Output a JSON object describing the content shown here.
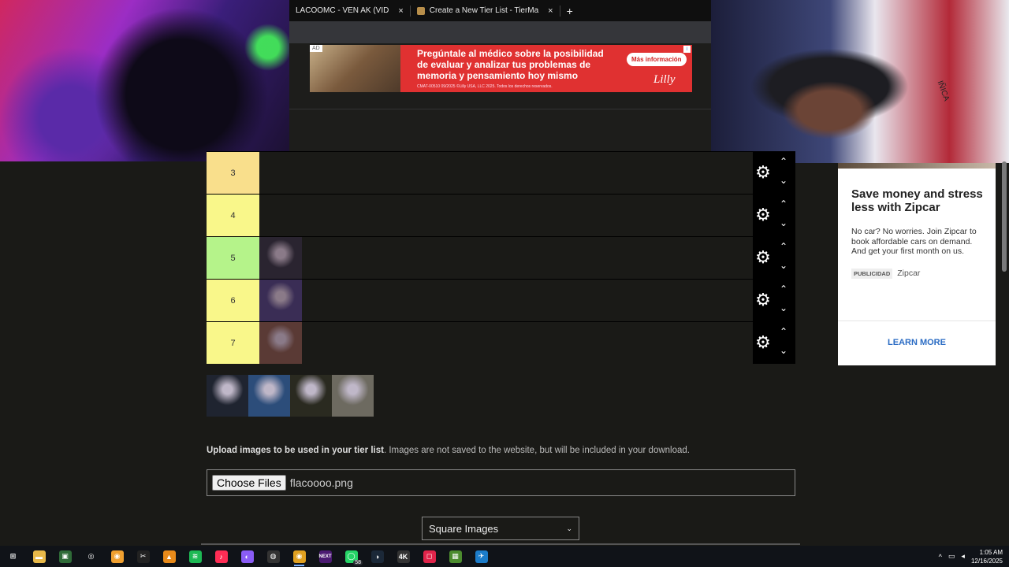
{
  "browser": {
    "tabs": [
      {
        "label": "LACOOMC - VEN AK (VID",
        "close": "×"
      },
      {
        "label": "Create a New Tier List - TierMa",
        "close": "×"
      }
    ],
    "new_tab": "+"
  },
  "top_ad": {
    "badge": "AD",
    "headline": "Pregúntale al médico sobre la posibilidad de evaluar y analizar tus problemas de memoria y pensamiento hoy mismo",
    "button": "Más información",
    "legal": "CMAT-00510 09/2025 ©Lilly USA, LLC 2025. Todos los derechos reservados.",
    "brand": "Lilly",
    "info": "i"
  },
  "tiers": [
    {
      "label": "3",
      "color": "#f9df8c",
      "items": []
    },
    {
      "label": "4",
      "color": "#f9f78a",
      "items": []
    },
    {
      "label": "5",
      "color": "#b5f38a",
      "items": [
        "#2a2430"
      ]
    },
    {
      "label": "6",
      "color": "#f9f78a",
      "items": [
        "#3a2d55"
      ]
    },
    {
      "label": "7",
      "color": "#f9f78a",
      "items": [
        "#5a3a35"
      ]
    }
  ],
  "controls": {
    "gear": "⚙",
    "up": "⌃",
    "down": "⌄"
  },
  "pool": [
    "#1f2430",
    "#2c4d7a",
    "#2a2a20",
    "#6d6a60"
  ],
  "upload": {
    "bold": "Upload images to be used in your tier list",
    "rest": ". Images are not saved to the website, but will be included in your download.",
    "button": "Choose Files",
    "file": "flacoooo.png"
  },
  "select": {
    "value": "Square Images",
    "caret": "⌄"
  },
  "side_ad": {
    "title": "Save money and stress less with Zipcar",
    "body": "No car? No worries. Join Zipcar to book affordable cars on demand. And get your first month on us.",
    "tag": "PUBLICIDAD",
    "advertiser": "Zipcar",
    "cta": "LEARN MORE"
  },
  "webcam_right": {
    "flag_text": "IÑICA"
  },
  "taskbar": {
    "icons": [
      {
        "name": "windows-start-icon",
        "glyph": "⊞",
        "bg": "transparent"
      },
      {
        "name": "file-explorer-icon",
        "glyph": "▬",
        "bg": "#e8b949"
      },
      {
        "name": "terminal-icon",
        "glyph": "▣",
        "bg": "#2f6b38"
      },
      {
        "name": "obs-icon",
        "glyph": "◎",
        "bg": "transparent"
      },
      {
        "name": "chat-app-icon",
        "glyph": "◉",
        "bg": "#f0a030"
      },
      {
        "name": "capcut-icon",
        "glyph": "✂",
        "bg": "#222"
      },
      {
        "name": "vlc-icon",
        "glyph": "▲",
        "bg": "#e88a1a"
      },
      {
        "name": "spotify-icon",
        "glyph": "≋",
        "bg": "#1db954"
      },
      {
        "name": "tiktok-icon",
        "glyph": "♪",
        "bg": "#ff2d55"
      },
      {
        "name": "messenger-icon",
        "glyph": "◐",
        "bg": "#8a5cf6"
      },
      {
        "name": "soccer-app-icon",
        "glyph": "◍",
        "bg": "#333"
      },
      {
        "name": "chrome-icon",
        "glyph": "◉",
        "bg": "#e0a020"
      },
      {
        "name": "next-app-icon",
        "glyph": "NEXT",
        "bg": "#4b1a72"
      },
      {
        "name": "whatsapp-icon",
        "glyph": "◯",
        "bg": "#25d366",
        "badge": "58"
      },
      {
        "name": "steam-icon",
        "glyph": "◑",
        "bg": "#1b2838"
      },
      {
        "name": "4k-downloader-icon",
        "glyph": "4K",
        "bg": "#333"
      },
      {
        "name": "red-app-icon",
        "glyph": "◻",
        "bg": "#e0244a"
      },
      {
        "name": "minecraft-icon",
        "glyph": "▦",
        "bg": "#4c8c2e"
      },
      {
        "name": "blue-app-icon",
        "glyph": "✈",
        "bg": "#1c7cc9"
      }
    ],
    "tray": {
      "chevron": "^",
      "network": "▭",
      "volume": "◂",
      "time": "1:05 AM",
      "date": "12/16/2025"
    }
  }
}
